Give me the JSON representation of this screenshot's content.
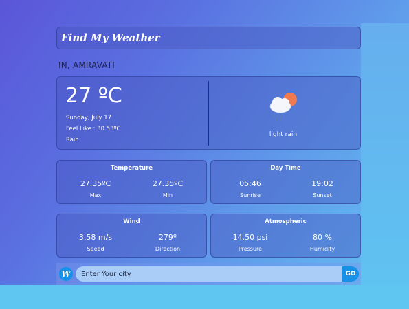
{
  "app": {
    "title": "Find My Weather"
  },
  "location": "IN, AMRAVATI",
  "current": {
    "temperature": "27 ºC",
    "date": "Sunday, July 17",
    "feels_like": "Feel Like : 30.53ºC",
    "condition": "Rain",
    "icon": "cloud-sun-rain-icon",
    "description": "light rain"
  },
  "cards": {
    "temperature": {
      "title": "Temperature",
      "max_value": "27.35ºC",
      "max_label": "Max",
      "min_value": "27.35ºC",
      "min_label": "Min"
    },
    "daytime": {
      "title": "Day Time",
      "sunrise_value": "05:46",
      "sunrise_label": "Sunrise",
      "sunset_value": "19:02",
      "sunset_label": "Sunset"
    },
    "wind": {
      "title": "Wind",
      "speed_value": "3.58 m/s",
      "speed_label": "Speed",
      "direction_value": "279º",
      "direction_label": "Direction"
    },
    "atmospheric": {
      "title": "Atmospheric",
      "pressure_value": "14.50 psi",
      "pressure_label": "Pressure",
      "humidity_value": "80 %",
      "humidity_label": "Humidity"
    }
  },
  "search": {
    "logo_letter": "W",
    "placeholder": "Enter Your city",
    "button_label": "GO"
  },
  "colors": {
    "accent": "#1790e8",
    "sun": "#f07a4f",
    "cloud": "#f4f6fb",
    "rain": "#5e7cb8"
  }
}
